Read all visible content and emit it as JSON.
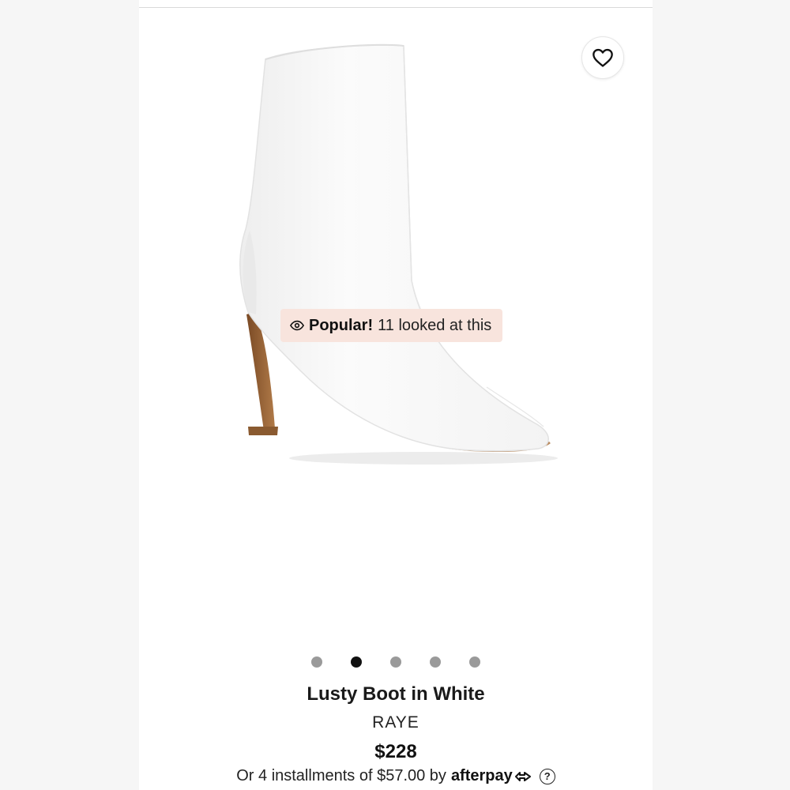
{
  "product": {
    "name": "Lusty Boot in White",
    "brand": "RAYE",
    "price": "$228"
  },
  "popular_badge": {
    "label": "Popular!",
    "text": "11 looked at this"
  },
  "carousel": {
    "total": 5,
    "active_index": 1
  },
  "installments": {
    "text": "Or 4 installments of $57.00 by",
    "provider": "afterpay",
    "help_symbol": "?"
  },
  "icons": {
    "favorite": "heart-outline-icon",
    "popular": "eye-icon",
    "provider": "afterpay-arrows-icon",
    "help": "question-circle-icon"
  },
  "colors": {
    "badge_bg": "#f8e4dd",
    "dot_active": "#111111",
    "dot_inactive": "#9a9a9a",
    "boot": "#fafafa",
    "heel_wood": "#a86f3c"
  }
}
